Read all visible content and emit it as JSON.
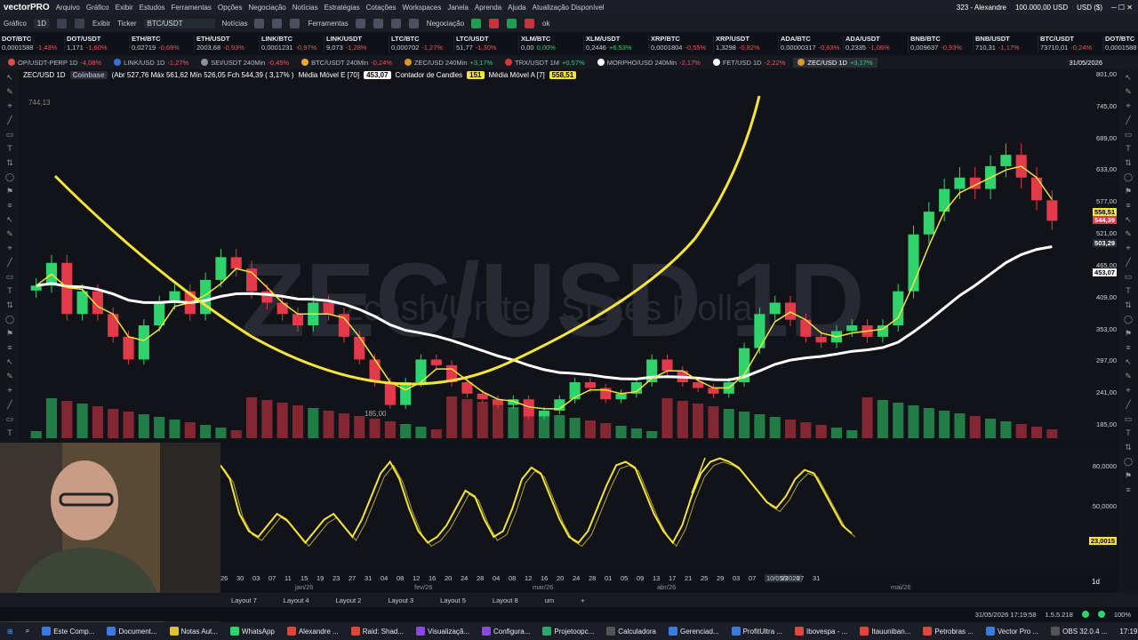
{
  "app": {
    "logo": "vectorPRO",
    "menu": [
      "Arquivo",
      "Gráfico",
      "Exibir",
      "Estudos",
      "Ferramentas",
      "Opções",
      "Negociação",
      "Notícias",
      "Estratégias",
      "Cotações",
      "Workspaces",
      "Janela",
      "Aprenda",
      "Ajuda",
      "Atualização Disponível"
    ],
    "account": "323 - Alexandre",
    "balance": "100.000,00 USD",
    "currency": "USD ($)"
  },
  "toolbar": {
    "grafico": "Gráfico",
    "interval": "1D",
    "exibir": "Exibir",
    "ticker_label": "Ticker",
    "ticker": "BTC/USDT",
    "noticias": "Notícias",
    "ferramentas": "Ferramentas",
    "negociacao": "Negociação",
    "ok": "ok"
  },
  "quotes": [
    {
      "name": "DOT/BTC",
      "price": "0,0001588",
      "chg": "-1,43%",
      "dir": "dn"
    },
    {
      "name": "DOT/USDT",
      "price": "1,171",
      "chg": "-1,60%",
      "dir": "dn"
    },
    {
      "name": "ETH/BTC",
      "price": "0,02719",
      "chg": "-0,69%",
      "dir": "dn"
    },
    {
      "name": "ETH/USDT",
      "price": "2003,68",
      "chg": "-0,93%",
      "dir": "dn"
    },
    {
      "name": "LINK/BTC",
      "price": "0,0001231",
      "chg": "-0,97%",
      "dir": "dn"
    },
    {
      "name": "LINK/USDT",
      "price": "9,073",
      "chg": "-1,28%",
      "dir": "dn"
    },
    {
      "name": "LTC/BTC",
      "price": "0,000702",
      "chg": "-1,27%",
      "dir": "dn"
    },
    {
      "name": "LTC/USDT",
      "price": "51,77",
      "chg": "-1,30%",
      "dir": "dn"
    },
    {
      "name": "XLM/BTC",
      "price": "0,00",
      "chg": "0,00%",
      "dir": "up"
    },
    {
      "name": "XLM/USDT",
      "price": "0,2446",
      "chg": "+6,53%",
      "dir": "up"
    },
    {
      "name": "XRP/BTC",
      "price": "0,0001804",
      "chg": "-0,55%",
      "dir": "dn"
    },
    {
      "name": "XRP/USDT",
      "price": "1,3298",
      "chg": "-0,82%",
      "dir": "dn"
    },
    {
      "name": "ADA/BTC",
      "price": "0,00000317",
      "chg": "-0,63%",
      "dir": "dn"
    },
    {
      "name": "ADA/USDT",
      "price": "0,2335",
      "chg": "-1,06%",
      "dir": "dn"
    },
    {
      "name": "BNB/BTC",
      "price": "0,009637",
      "chg": "-0,93%",
      "dir": "dn"
    },
    {
      "name": "BNB/USDT",
      "price": "710,31",
      "chg": "-1,17%",
      "dir": "dn"
    },
    {
      "name": "BTC/USDT",
      "price": "73710,01",
      "chg": "-0,24%",
      "dir": "dn"
    },
    {
      "name": "DOT/BTC",
      "price": "0,0001588",
      "chg": "-1,43%",
      "dir": "dn"
    }
  ],
  "tabs": [
    {
      "label": "OP/USDT-PERP 1D",
      "chg": "-4,08%",
      "color": "#e04a4a"
    },
    {
      "label": "LINK/USD 1D",
      "chg": "-1,27%",
      "color": "#3b6fd8"
    },
    {
      "label": "SEI/USDT 240Min",
      "chg": "-0,45%",
      "color": "#8a8f99"
    },
    {
      "label": "BTC/USDT 240Min",
      "chg": "-0,24%",
      "color": "#f2a530"
    },
    {
      "label": "ZEC/USD 240Min",
      "chg": "+3,17%",
      "color": "#d89a2b"
    },
    {
      "label": "TRX/USDT 1M",
      "chg": "+0,57%",
      "color": "#d8363b"
    },
    {
      "label": "MORPHO/USD 240Min",
      "chg": "-2,17%",
      "color": "#ffffff"
    },
    {
      "label": "FET/USD 1D",
      "chg": "-2,22%",
      "color": "#ffffff"
    },
    {
      "label": "ZEC/USD 1D",
      "chg": "+3,17%",
      "color": "#d89a2b"
    }
  ],
  "tabs_date": "31/05/2026",
  "legend": {
    "symbol": "ZEC/USD 1D",
    "exchange": "Coinbase",
    "ohlc": "(Abr 527,76 Máx 561,62 Mín 526,05 Fch 544,39 ( 3,17% )",
    "ma_e": "Média Móvel E [70]",
    "ma_e_val": "453,07",
    "counter": "Contador de Candles",
    "counter_val": "151",
    "ma_a": "Média Móvel A [7]",
    "ma_a_val": "558,51"
  },
  "watermark": {
    "big": "ZEC/USD 1D",
    "sub": "Zcash/United States Dollar"
  },
  "price_axis": [
    "801,00",
    "745,00",
    "689,00",
    "633,00",
    "577,00",
    "521,00",
    "465,00",
    "409,00",
    "353,00",
    "297,00",
    "241,00",
    "185,00"
  ],
  "price_tags": {
    "ma_a": "558,51",
    "last": "544,39",
    "cross": "503,29",
    "ma_e": "453,07"
  },
  "chart_labels": {
    "high": "744,13",
    "low": "185,00"
  },
  "chart_data": {
    "type": "candlestick",
    "symbol": "ZEC/USD",
    "interval": "1D",
    "last_close": 544.39,
    "ma_exp_70": 453.07,
    "ma_arith_7": 558.51,
    "ylim": [
      185,
      801
    ],
    "approx_closes": [
      430,
      470,
      380,
      420,
      380,
      340,
      300,
      360,
      400,
      420,
      380,
      440,
      480,
      460,
      420,
      400,
      380,
      360,
      400,
      380,
      340,
      300,
      260,
      220,
      260,
      300,
      290,
      260,
      240,
      230,
      220,
      230,
      200,
      210,
      230,
      260,
      250,
      230,
      240,
      260,
      300,
      280,
      260,
      250,
      240,
      260,
      320,
      380,
      400,
      370,
      340,
      330,
      350,
      360,
      340,
      360,
      420,
      520,
      560,
      600,
      620,
      600,
      640,
      660,
      620,
      580,
      544
    ]
  },
  "oscillator": {
    "axis": [
      "80,0000",
      "50,0000"
    ],
    "current": "23,0015",
    "values": [
      82,
      70,
      40,
      25,
      20,
      30,
      40,
      35,
      25,
      15,
      25,
      35,
      40,
      30,
      20,
      35,
      55,
      75,
      85,
      70,
      45,
      25,
      15,
      20,
      30,
      45,
      60,
      55,
      35,
      20,
      25,
      45,
      70,
      80,
      75,
      55,
      35,
      20,
      15,
      25,
      45,
      65,
      82,
      85,
      80,
      60,
      40,
      25,
      15,
      30,
      55,
      75,
      85,
      88,
      85,
      80,
      70,
      60,
      50,
      45,
      55,
      70,
      78,
      75,
      60,
      45,
      30,
      23
    ]
  },
  "dates": {
    "days": [
      "26",
      "30",
      "03",
      "07",
      "11",
      "15",
      "19",
      "23",
      "27",
      "31",
      "04",
      "08",
      "12",
      "16",
      "20",
      "24",
      "28",
      "04",
      "08",
      "12",
      "16",
      "20",
      "24",
      "28",
      "01",
      "05",
      "09",
      "13",
      "17",
      "21",
      "25",
      "29",
      "03",
      "07",
      "10/05/2026",
      "23",
      "27",
      "31"
    ],
    "months": [
      "jan/26",
      "fev/26",
      "mar/26",
      "abr/26",
      "mai/26"
    ],
    "interval": "1d"
  },
  "layouts": [
    "Layout 7",
    "Layout 4",
    "Layout 2",
    "Layout 3",
    "Layout 5",
    "Layout 8",
    "um"
  ],
  "status": {
    "datetime": "31/05/2026 17:19:58",
    "version": "1.5.5.218",
    "zoom": "100%"
  },
  "taskbar": [
    "Este Comp...",
    "Document...",
    "Notas Aut...",
    "WhatsApp",
    "Alexandre ...",
    "Raid: Shad...",
    "Visualizaçã...",
    "Configura...",
    "Projetoopc...",
    "Calculadora",
    "Gerenciad...",
    "ProfitUltra ...",
    "Ibovespa - ...",
    "Itauuniban...",
    "Petrobras ...",
    "Vector Pro ...",
    "OBS 32.0.4 ..."
  ],
  "taskbar_clock": "17:19",
  "colors": {
    "bull": "#2fd36b",
    "bear": "#e23a4a",
    "ma_a": "#f5e53b",
    "ma_e": "#ffffff",
    "drawing": "#f5e53b"
  }
}
